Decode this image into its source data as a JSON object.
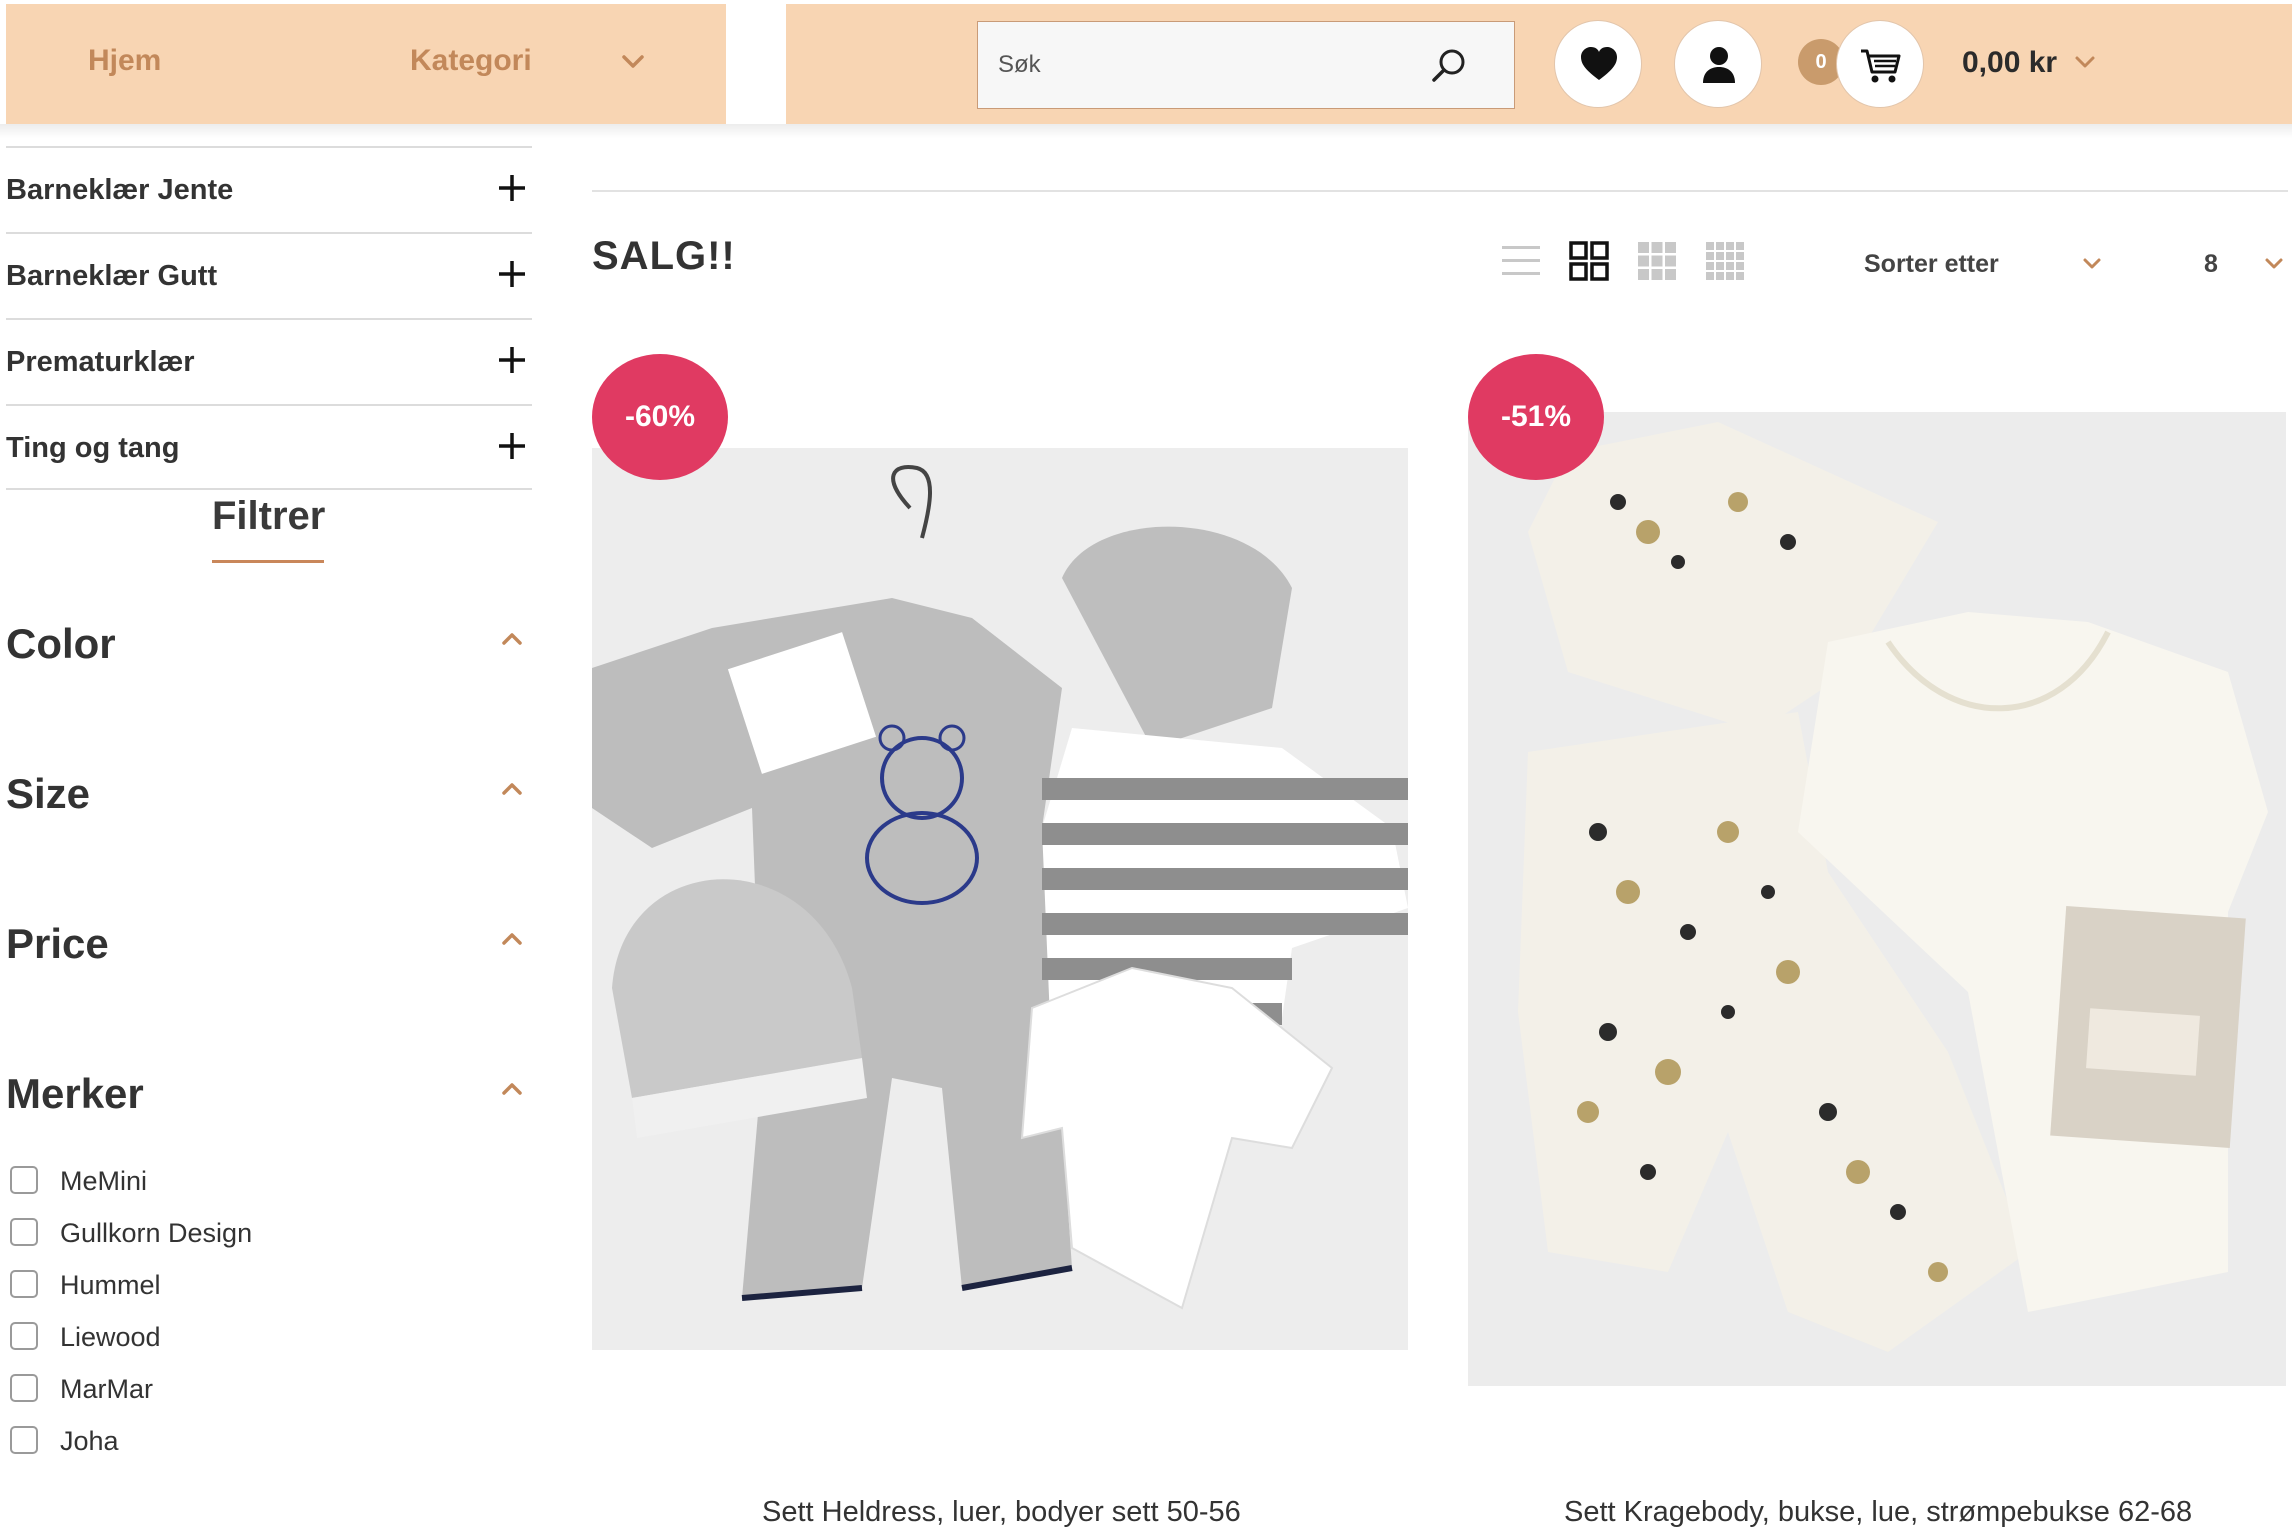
{
  "header": {
    "nav": {
      "home": "Hjem",
      "category": "Kategori"
    },
    "search": {
      "placeholder": "Søk"
    },
    "cart": {
      "count": "0",
      "total": "0,00 kr"
    },
    "icons": [
      "chevron-down-icon",
      "search-icon",
      "heart-icon",
      "user-icon",
      "cart-icon"
    ]
  },
  "sidebar": {
    "categories": [
      {
        "label": "Barneklær Jente"
      },
      {
        "label": "Barneklær Gutt"
      },
      {
        "label": "Prematurklær"
      },
      {
        "label": "Ting og tang"
      }
    ],
    "filter_title": "Filtrer",
    "facets": [
      {
        "label": "Color"
      },
      {
        "label": "Size"
      },
      {
        "label": "Price"
      },
      {
        "label": "Merker"
      }
    ],
    "brands": [
      "MeMini",
      "Gullkorn Design",
      "Hummel",
      "Liewood",
      "MarMar",
      "Joha"
    ]
  },
  "main": {
    "title": "SALG!!",
    "sort_label": "Sorter etter",
    "per_page": "8",
    "view_modes": [
      "list-view-icon",
      "grid-2-icon",
      "grid-3-icon",
      "grid-4-icon"
    ],
    "products": [
      {
        "name": "Sett Heldress, luer, bodyer sett 50-56",
        "discount": "-60%"
      },
      {
        "name": "Sett Kragebody, bukse, lue, strømpebukse 62-68",
        "discount": "-51%"
      }
    ]
  },
  "colors": {
    "header_bg": "#f8d5b3",
    "nav_text": "#c2885a",
    "badge": "#e03a62",
    "accent": "#c9875a"
  }
}
